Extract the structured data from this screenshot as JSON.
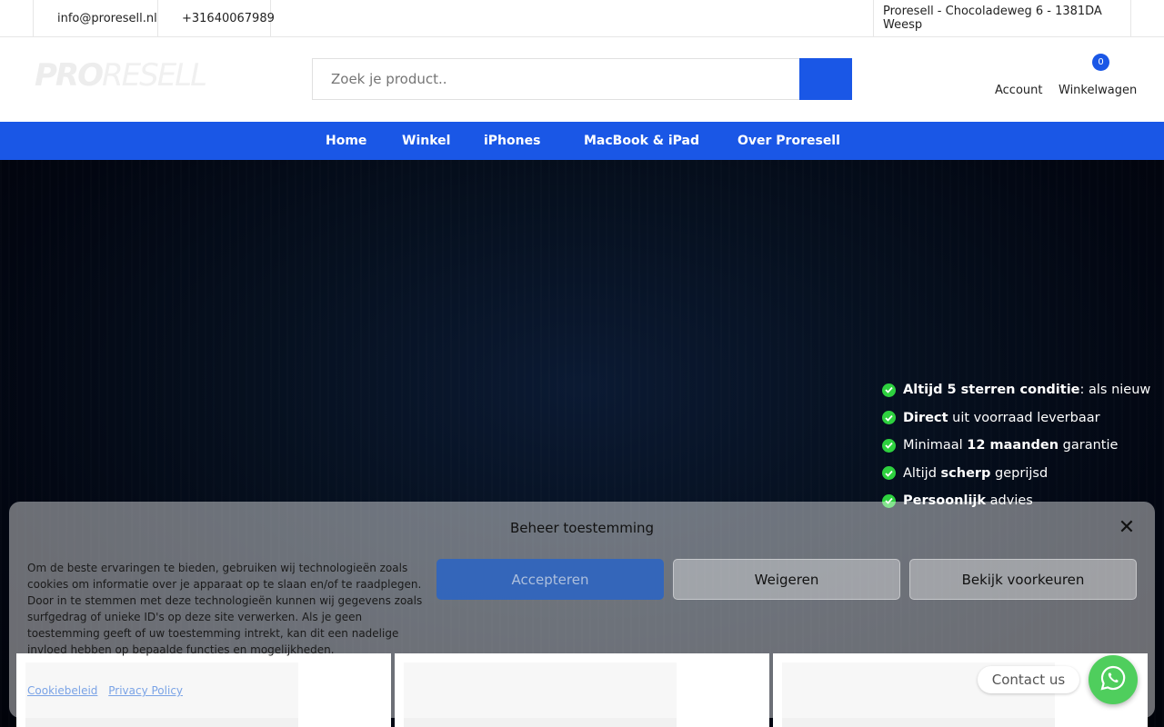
{
  "topbar": {
    "email": "info@proresell.nl",
    "phone": "+31640067989",
    "address": "Proresell - Chocoladeweg 6 - 1381DA Weesp"
  },
  "header": {
    "logo_bold": "PRO",
    "logo_rest": "RESELL",
    "search_placeholder": "Zoek je product..",
    "account_label": "Account",
    "cart_label": "Winkelwagen",
    "cart_count": "0"
  },
  "nav": {
    "items": [
      {
        "label": "Home"
      },
      {
        "label": "Winkel"
      },
      {
        "label": "iPhones"
      },
      {
        "label": "MacBook & iPad"
      },
      {
        "label": "Over Proresell"
      }
    ]
  },
  "hero": {
    "features": [
      {
        "bold": "Altijd 5 sterren conditie",
        "rest": ": als nieuw",
        "pre": ""
      },
      {
        "bold": "Direct",
        "rest": " uit voorraad leverbaar",
        "pre": ""
      },
      {
        "pre": "Minimaal ",
        "bold": "12 maanden",
        "rest": " garantie"
      },
      {
        "pre": "Altijd ",
        "bold": "scherp",
        "rest": " geprijsd"
      },
      {
        "pre": "",
        "bold": "Persoonlijk",
        "rest": " advies"
      }
    ]
  },
  "consent": {
    "title": "Beheer toestemming",
    "text": "Om de beste ervaringen te bieden, gebruiken wij technologieën zoals cookies om informatie over je apparaat op te slaan en/of te raadplegen. Door in te stemmen met deze technologieën kunnen wij gegevens zoals surfgedrag of unieke ID's op deze site verwerken. Als je geen toestemming geeft of uw toestemming intrekt, kan dit een nadelige invloed hebben op bepaalde functies en mogelijkheden.",
    "accept_label": "Accepteren",
    "deny_label": "Weigeren",
    "prefs_label": "Bekijk voorkeuren",
    "link_cookie": "Cookiebeleid",
    "link_privacy": "Privacy Policy"
  },
  "contact": {
    "label": "Contact us"
  },
  "colors": {
    "brand_blue": "#1a57e6",
    "check_green": "#2ed13f",
    "whatsapp_green": "#4fce5d"
  }
}
